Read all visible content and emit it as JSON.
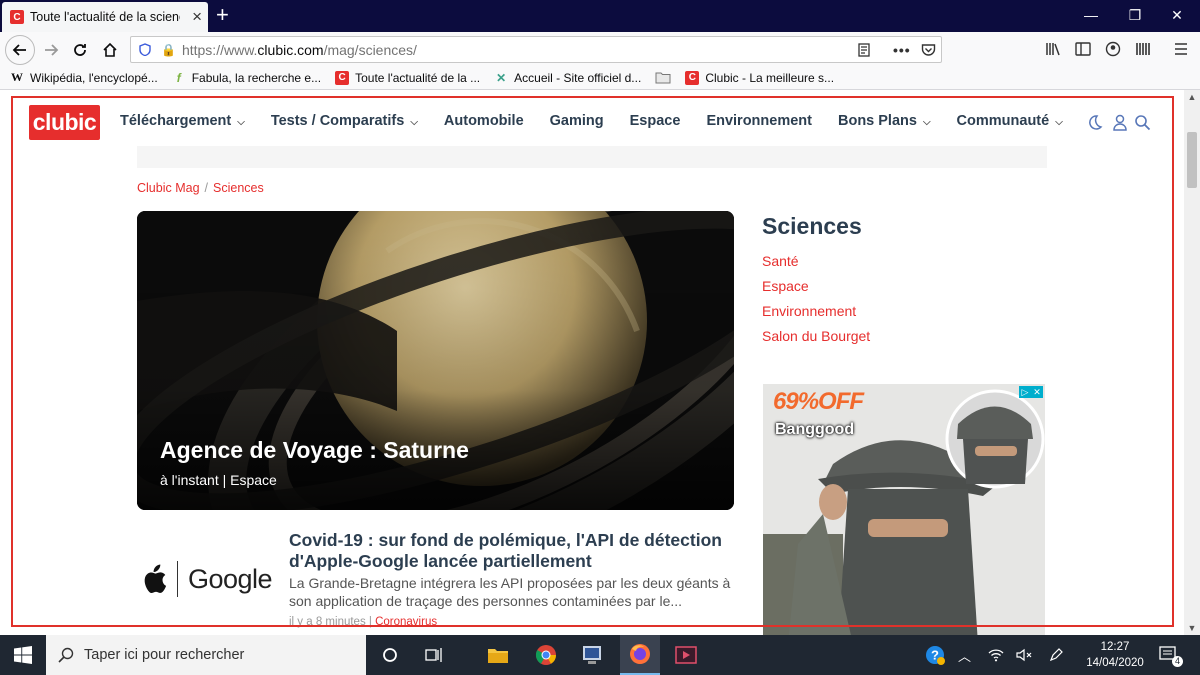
{
  "browser": {
    "tab_title": "Toute l'actualité de la science et",
    "url_prefix": "https://www.",
    "url_domain": "clubic.com",
    "url_path": "/mag/sciences/",
    "bookmarks": [
      {
        "icon": "W",
        "label": "Wikipédia, l'encyclopé..."
      },
      {
        "icon": "f",
        "label": "Fabula, la recherche e..."
      },
      {
        "icon": "C",
        "label": "Toute l'actualité de la ..."
      },
      {
        "icon": "✕",
        "label": "Accueil - Site officiel d..."
      },
      {
        "icon": "folder",
        "label": ""
      },
      {
        "icon": "C",
        "label": "Clubic - La meilleure s..."
      }
    ]
  },
  "site": {
    "logo": "clubic",
    "nav": [
      {
        "label": "Téléchargement",
        "dropdown": true
      },
      {
        "label": "Tests / Comparatifs",
        "dropdown": true
      },
      {
        "label": "Automobile",
        "dropdown": false
      },
      {
        "label": "Gaming",
        "dropdown": false
      },
      {
        "label": "Espace",
        "dropdown": false
      },
      {
        "label": "Environnement",
        "dropdown": false
      },
      {
        "label": "Bons Plans",
        "dropdown": true
      },
      {
        "label": "Communauté",
        "dropdown": true
      }
    ],
    "breadcrumb": [
      "Clubic Mag",
      "Sciences"
    ],
    "hero": {
      "title": "Agence de Voyage : Saturne",
      "meta": "à l'instant | Espace"
    },
    "article": {
      "thumb_brand": "Google",
      "title": "Covid-19 : sur fond de polémique, l'API de détection d'Apple-Google lancée partiellement",
      "excerpt": "La Grande-Bretagne intégrera les API proposées par les deux géants à son application de traçage des personnes contaminées par le...",
      "time": "il y a 8 minutes",
      "tag": "Coronavirus"
    },
    "sidebar": {
      "title": "Sciences",
      "links": [
        "Santé",
        "Espace",
        "Environnement",
        "Salon du Bourget"
      ]
    },
    "ad": {
      "off": "69%OFF",
      "brand": "Banggood"
    }
  },
  "taskbar": {
    "search_placeholder": "Taper ici pour rechercher",
    "time": "12:27",
    "date": "14/04/2020",
    "notifications": "4"
  }
}
